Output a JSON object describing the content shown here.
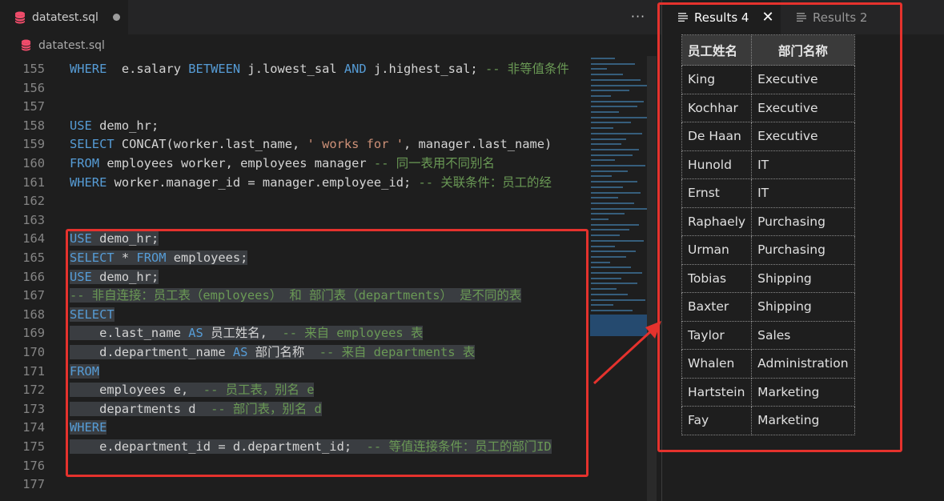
{
  "editor": {
    "tab_title": "datatest.sql",
    "breadcrumb": "datatest.sql",
    "more_label": "···",
    "lines": [
      {
        "n": "155",
        "parts": [
          [
            "kw",
            "WHERE"
          ],
          [
            "",
            "  e.salary "
          ],
          [
            "kw",
            "BETWEEN"
          ],
          [
            "",
            " j.lowest_sal "
          ],
          [
            "kw",
            "AND"
          ],
          [
            "",
            " j.highest_sal; "
          ],
          [
            "cmt",
            "-- 非等值条件"
          ]
        ]
      },
      {
        "n": "156",
        "parts": []
      },
      {
        "n": "157",
        "parts": []
      },
      {
        "n": "158",
        "parts": [
          [
            "kw",
            "USE"
          ],
          [
            "",
            " demo_hr;"
          ]
        ]
      },
      {
        "n": "159",
        "parts": [
          [
            "kw",
            "SELECT"
          ],
          [
            "",
            " CONCAT(worker.last_name, "
          ],
          [
            "str",
            "' works for '"
          ],
          [
            "",
            ", manager.last_name)"
          ]
        ]
      },
      {
        "n": "160",
        "parts": [
          [
            "kw",
            "FROM"
          ],
          [
            "",
            " employees worker, employees manager "
          ],
          [
            "cmt",
            "-- 同一表用不同别名"
          ]
        ]
      },
      {
        "n": "161",
        "parts": [
          [
            "kw",
            "WHERE"
          ],
          [
            "",
            " worker.manager_id = manager.employee_id; "
          ],
          [
            "cmt",
            "-- 关联条件：员工的经"
          ]
        ]
      },
      {
        "n": "162",
        "parts": []
      },
      {
        "n": "163",
        "parts": []
      },
      {
        "n": "164",
        "sel": true,
        "parts": [
          [
            "kw",
            "USE"
          ],
          [
            "",
            " demo_hr;"
          ]
        ]
      },
      {
        "n": "165",
        "sel": true,
        "parts": [
          [
            "kw",
            "SELECT"
          ],
          [
            "",
            " * "
          ],
          [
            "kw",
            "FROM"
          ],
          [
            "",
            " employees;"
          ]
        ]
      },
      {
        "n": "166",
        "sel": true,
        "parts": [
          [
            "kw",
            "USE"
          ],
          [
            "",
            " demo_hr;"
          ]
        ]
      },
      {
        "n": "167",
        "sel": true,
        "parts": [
          [
            "cmt",
            "-- 非自连接：员工表（employees） 和 部门表（departments） 是不同的表"
          ]
        ]
      },
      {
        "n": "168",
        "sel": true,
        "parts": [
          [
            "kw",
            "SELECT"
          ]
        ]
      },
      {
        "n": "169",
        "sel": true,
        "parts": [
          [
            "",
            "    e.last_name "
          ],
          [
            "kw",
            "AS"
          ],
          [
            "",
            " 员工姓名,  "
          ],
          [
            "cmt",
            "-- 来自 employees 表"
          ]
        ]
      },
      {
        "n": "170",
        "sel": true,
        "parts": [
          [
            "",
            "    d.department_name "
          ],
          [
            "kw",
            "AS"
          ],
          [
            "",
            " 部门名称  "
          ],
          [
            "cmt",
            "-- 来自 departments 表"
          ]
        ]
      },
      {
        "n": "171",
        "sel": true,
        "parts": [
          [
            "kw",
            "FROM"
          ]
        ]
      },
      {
        "n": "172",
        "sel": true,
        "parts": [
          [
            "",
            "    employees e,  "
          ],
          [
            "cmt",
            "-- 员工表，别名 e"
          ]
        ]
      },
      {
        "n": "173",
        "sel": true,
        "parts": [
          [
            "",
            "    departments d  "
          ],
          [
            "cmt",
            "-- 部门表，别名 d"
          ]
        ]
      },
      {
        "n": "174",
        "sel": true,
        "parts": [
          [
            "kw",
            "WHERE"
          ]
        ]
      },
      {
        "n": "175",
        "sel": true,
        "parts": [
          [
            "",
            "    e.department_id = d.department_id;  "
          ],
          [
            "cmt",
            "-- 等值连接条件：员工的部门ID"
          ]
        ]
      },
      {
        "n": "176",
        "parts": []
      },
      {
        "n": "177",
        "parts": []
      }
    ]
  },
  "results": {
    "tabs": [
      {
        "label": "Results 4",
        "active": true
      },
      {
        "label": "Results 2",
        "active": false
      }
    ],
    "columns": [
      "员工姓名",
      "部门名称"
    ],
    "rows": [
      [
        "King",
        "Executive"
      ],
      [
        "Kochhar",
        "Executive"
      ],
      [
        "De Haan",
        "Executive"
      ],
      [
        "Hunold",
        "IT"
      ],
      [
        "Ernst",
        "IT"
      ],
      [
        "Raphaely",
        "Purchasing"
      ],
      [
        "Urman",
        "Purchasing"
      ],
      [
        "Tobias",
        "Shipping"
      ],
      [
        "Baxter",
        "Shipping"
      ],
      [
        "Taylor",
        "Sales"
      ],
      [
        "Whalen",
        "Administration"
      ],
      [
        "Hartstein",
        "Marketing"
      ],
      [
        "Fay",
        "Marketing"
      ]
    ]
  },
  "colors": {
    "annotation_red": "#e5322d",
    "keyword_blue": "#569cd6",
    "comment_green": "#6a9955",
    "string_orange": "#ce9178"
  }
}
